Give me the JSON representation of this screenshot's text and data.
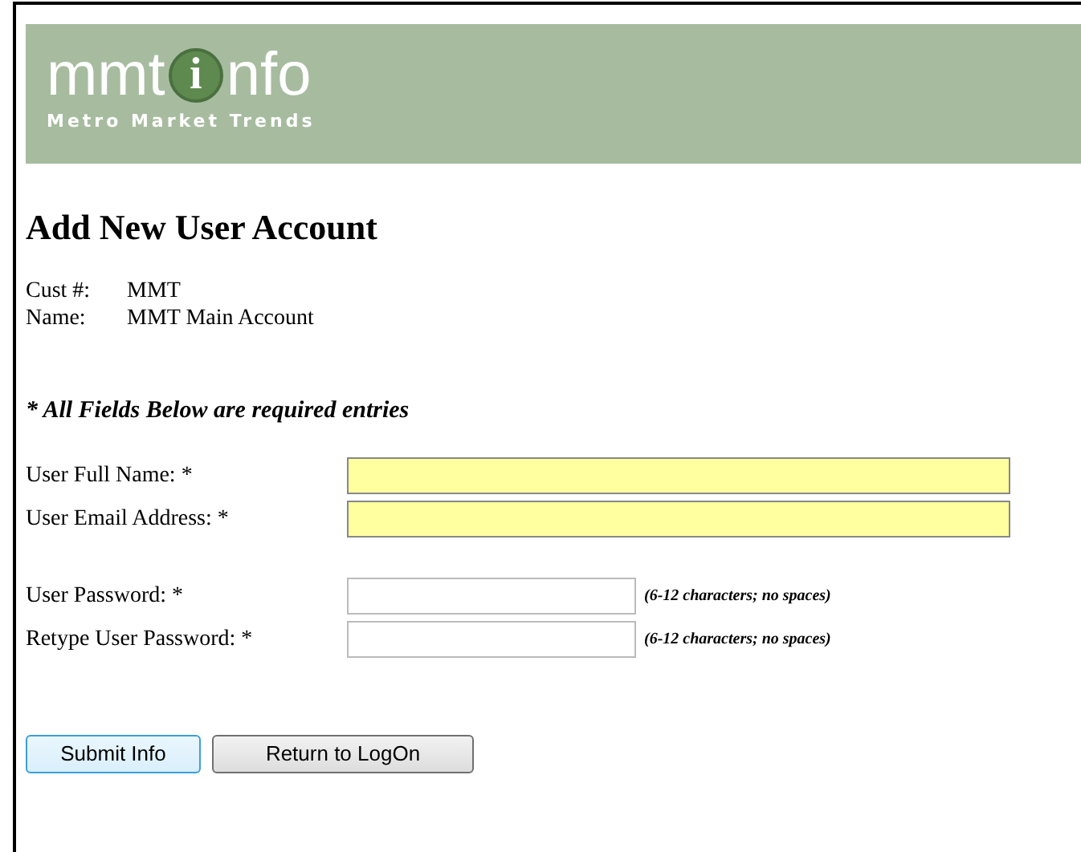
{
  "logo": {
    "before": "mmt",
    "badge": "i",
    "after": "nfo",
    "tagline": "Metro Market Trends"
  },
  "title": "Add New User Account",
  "info": [
    {
      "label": "Cust #:",
      "value": "MMT"
    },
    {
      "label": "Name:",
      "value": "MMT Main Account"
    }
  ],
  "note": "* All Fields Below are required entries",
  "field_groups": [
    [
      {
        "label": "User Full Name: *",
        "required_highlight": true
      },
      {
        "label": "User Email Address: *",
        "required_highlight": true
      }
    ],
    [
      {
        "label": "User Password: *",
        "required_highlight": false,
        "hint": "(6-12 characters; no spaces)"
      },
      {
        "label": "Retype User Password: *",
        "required_highlight": false,
        "hint": "(6-12 characters; no spaces)"
      }
    ]
  ],
  "buttons": [
    {
      "label": "Submit Info",
      "focused": true
    },
    {
      "label": "Return to LogOn",
      "focused": false
    }
  ]
}
